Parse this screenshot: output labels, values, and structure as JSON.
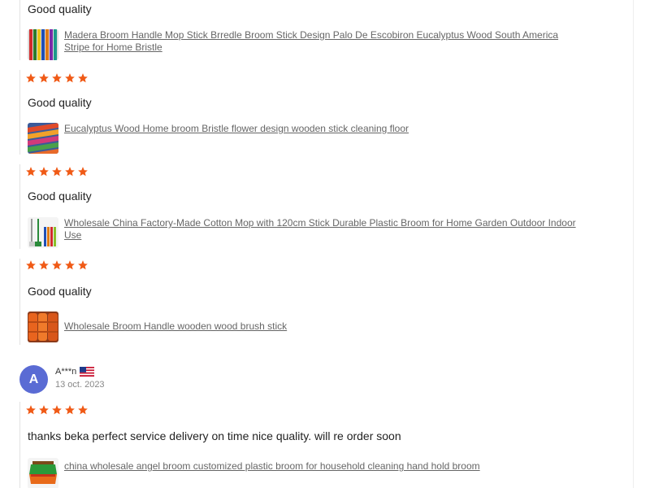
{
  "reviews": [
    {
      "text": "Good quality",
      "product": "Madera Broom Handle Mop Stick Brredle Broom Stick Design Palo De Escobiron Eucalyptus Wood South America Stripe for Home Bristle",
      "thumb": "striped-sticks"
    },
    {
      "stars": 5,
      "text": "Good quality",
      "product": "Eucalyptus Wood Home broom Bristle flower design wooden stick cleaning floor",
      "thumb": "woven-pattern"
    },
    {
      "stars": 5,
      "text": "Good quality",
      "product": "Wholesale China Factory-Made Cotton Mop with 120cm Stick Durable Plastic Broom for Home Garden Outdoor Indoor Use",
      "thumb": "mop-broom"
    },
    {
      "stars": 5,
      "text": "Good quality",
      "product": "Wholesale Broom Handle wooden wood brush stick",
      "thumb": "orange-rolls"
    }
  ],
  "reviewer": {
    "avatar_letter": "A",
    "name": "A***n",
    "flag": "us-flag",
    "date": "13 oct. 2023",
    "stars": 5,
    "text": "thanks beka perfect service delivery on time nice quality. will re order soon",
    "product": "china wholesale angel broom customized plastic broom for household cleaning hand hold broom",
    "thumb": "green-orange-broom"
  },
  "colors": {
    "star": "#f05a16",
    "avatar": "#5a6bd4",
    "link": "#666666",
    "text": "#222222"
  }
}
